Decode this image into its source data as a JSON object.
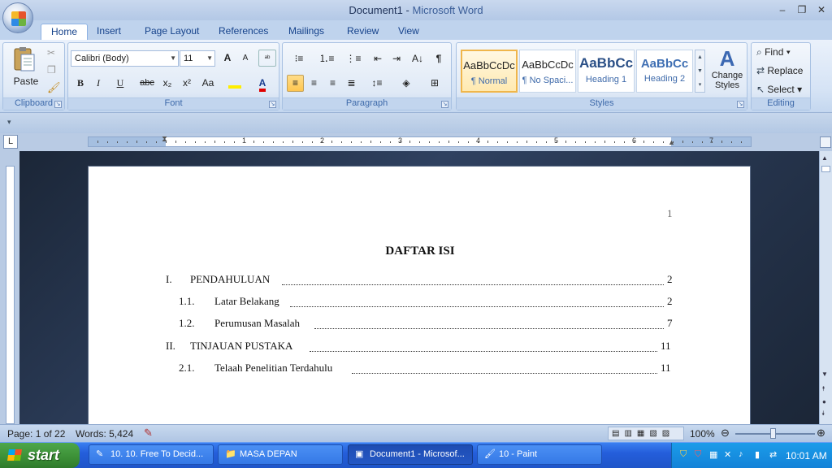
{
  "window": {
    "title_doc": "Document1 - ",
    "title_app": "Microsoft Word",
    "minimize": "‒",
    "restore": "❐",
    "close": "✕"
  },
  "tabs": [
    "Home",
    "Insert",
    "Page Layout",
    "References",
    "Mailings",
    "Review",
    "View"
  ],
  "clipboard": {
    "paste_label": "Paste",
    "group_label": "Clipboard"
  },
  "font": {
    "name": "Calibri (Body)",
    "size": "11",
    "group_label": "Font",
    "bold": "B",
    "italic": "I",
    "underline": "U",
    "strike": "abc",
    "subscript": "x₂",
    "superscript": "x²",
    "change_case": "Aa",
    "grow": "A",
    "shrink": "A"
  },
  "paragraph": {
    "group_label": "Paragraph",
    "pilcrow": "¶"
  },
  "styles": {
    "group_label": "Styles",
    "change_styles_line1": "Change",
    "change_styles_line2": "Styles",
    "items": [
      {
        "sample": "AaBbCcDc",
        "name": "¶ Normal"
      },
      {
        "sample": "AaBbCcDc",
        "name": "¶ No Spaci..."
      },
      {
        "sample": "AaBbCc",
        "name": "Heading 1"
      },
      {
        "sample": "AaBbCc",
        "name": "Heading 2"
      }
    ]
  },
  "editing": {
    "group_label": "Editing",
    "find": "Find",
    "replace": "Replace",
    "select": "Select"
  },
  "ruler_numbers": [
    "1",
    "2",
    "3",
    "4",
    "5",
    "6",
    "7"
  ],
  "document": {
    "page_number": "1",
    "heading": "DAFTAR ISI",
    "toc": [
      {
        "num": "I.",
        "text": "PENDAHULUAN",
        "page": "2"
      },
      {
        "num": "1.1.",
        "text": "Latar Belakang",
        "page": "2"
      },
      {
        "num": "1.2.",
        "text": "Perumusan Masalah",
        "page": "7"
      },
      {
        "num": "II.",
        "text": "TINJAUAN PUSTAKA",
        "page": "11"
      },
      {
        "num": "2.1.",
        "text": "Telaah Penelitian Terdahulu",
        "page": "11"
      }
    ]
  },
  "status": {
    "page": "Page: 1 of 22",
    "words": "Words: 5,424",
    "zoom": "100%"
  },
  "taskbar": {
    "start": "start",
    "items": [
      "10. 10. Free To Decid...",
      "MASA DEPAN",
      "Document1 - Microsof...",
      "10 - Paint"
    ],
    "clock": "10:01 AM"
  }
}
